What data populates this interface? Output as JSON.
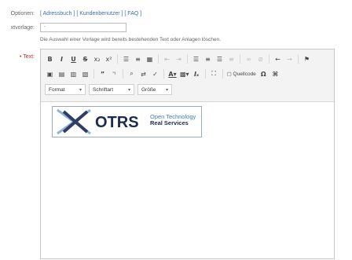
{
  "options": {
    "label": "Optionen:",
    "links": [
      "[ Adressbuch ]",
      "[ Kundenbenutzer ]",
      "[ FAQ ]"
    ]
  },
  "template": {
    "label": "xtvorlage:",
    "value": "-",
    "hint": "Die Auswahl einer Vorlage wird bereits bestehenden Text oder Anlagen löschen."
  },
  "text_field": {
    "label": "• Text:"
  },
  "toolbar": {
    "row1": [
      {
        "name": "bold-button",
        "glyph": "B",
        "style": "b"
      },
      {
        "name": "italic-button",
        "glyph": "I",
        "style": "i"
      },
      {
        "name": "underline-button",
        "glyph": "U",
        "style": "u"
      },
      {
        "name": "strike-button",
        "glyph": "S",
        "style": "s"
      },
      {
        "name": "subscript-button",
        "glyph": "x₂",
        "style": ""
      },
      {
        "name": "superscript-button",
        "glyph": "x²",
        "style": ""
      },
      {
        "name": "numbered-list-button",
        "glyph": "☰",
        "style": ""
      },
      {
        "name": "bulleted-list-button",
        "glyph": "≡",
        "style": ""
      },
      {
        "name": "table-button",
        "glyph": "▦",
        "style": ""
      },
      {
        "name": "outdent-button",
        "glyph": "⇤",
        "style": "dim"
      },
      {
        "name": "indent-button",
        "glyph": "⇥",
        "style": "dim"
      },
      {
        "name": "align-left-button",
        "glyph": "☰",
        "style": ""
      },
      {
        "name": "align-center-button",
        "glyph": "≡",
        "style": ""
      },
      {
        "name": "align-right-button",
        "glyph": "☰",
        "style": ""
      },
      {
        "name": "justify-button",
        "glyph": "≡",
        "style": "dim"
      },
      {
        "name": "link-button",
        "glyph": "∞",
        "style": "dim"
      },
      {
        "name": "unlink-button",
        "glyph": "⊘",
        "style": "dim"
      },
      {
        "name": "undo-button",
        "glyph": "←",
        "style": ""
      },
      {
        "name": "redo-button",
        "glyph": "→",
        "style": "dim"
      },
      {
        "name": "flag-button",
        "glyph": "⚑",
        "style": ""
      }
    ],
    "row2": [
      {
        "name": "image-button",
        "glyph": "▣",
        "style": ""
      },
      {
        "name": "paste-button",
        "glyph": "▤",
        "style": ""
      },
      {
        "name": "paste-text-button",
        "glyph": "▥",
        "style": ""
      },
      {
        "name": "paste-word-button",
        "glyph": "▧",
        "style": ""
      },
      {
        "name": "blockquote-button",
        "glyph": "”",
        "style": "b"
      },
      {
        "name": "special-quote-button",
        "glyph": "”¹",
        "style": "txt"
      },
      {
        "name": "find-button",
        "glyph": "⌕",
        "style": ""
      },
      {
        "name": "replace-button",
        "glyph": "⇄",
        "style": ""
      },
      {
        "name": "spellcheck-button",
        "glyph": "✓",
        "style": ""
      },
      {
        "name": "text-color-button",
        "glyph": "A▾",
        "style": "u"
      },
      {
        "name": "bg-color-button",
        "glyph": "▩▾",
        "style": ""
      },
      {
        "name": "remove-format-button",
        "glyph": "Iₓ",
        "style": "i"
      },
      {
        "name": "fullscreen-button",
        "glyph": "⛶",
        "style": ""
      },
      {
        "name": "source-button",
        "glyph": "▢ Quellcode",
        "style": "txt"
      },
      {
        "name": "special-char-button",
        "glyph": "Ω",
        "style": "b"
      },
      {
        "name": "maximize-button",
        "glyph": "⌘",
        "style": "b"
      }
    ],
    "combos": [
      {
        "name": "format-combo",
        "label": "Format"
      },
      {
        "name": "font-combo",
        "label": "Schriftart"
      },
      {
        "name": "size-combo",
        "label": "Größe"
      }
    ]
  },
  "logo": {
    "name": "OTRS",
    "tagline_1": "Open Technology",
    "tagline_2": "Real Services",
    "colors": {
      "dark": "#1d2b4f",
      "accent": "#3a7fb8",
      "cross_light": "#8fb4d8",
      "cross_dark": "#2f3d63"
    }
  }
}
